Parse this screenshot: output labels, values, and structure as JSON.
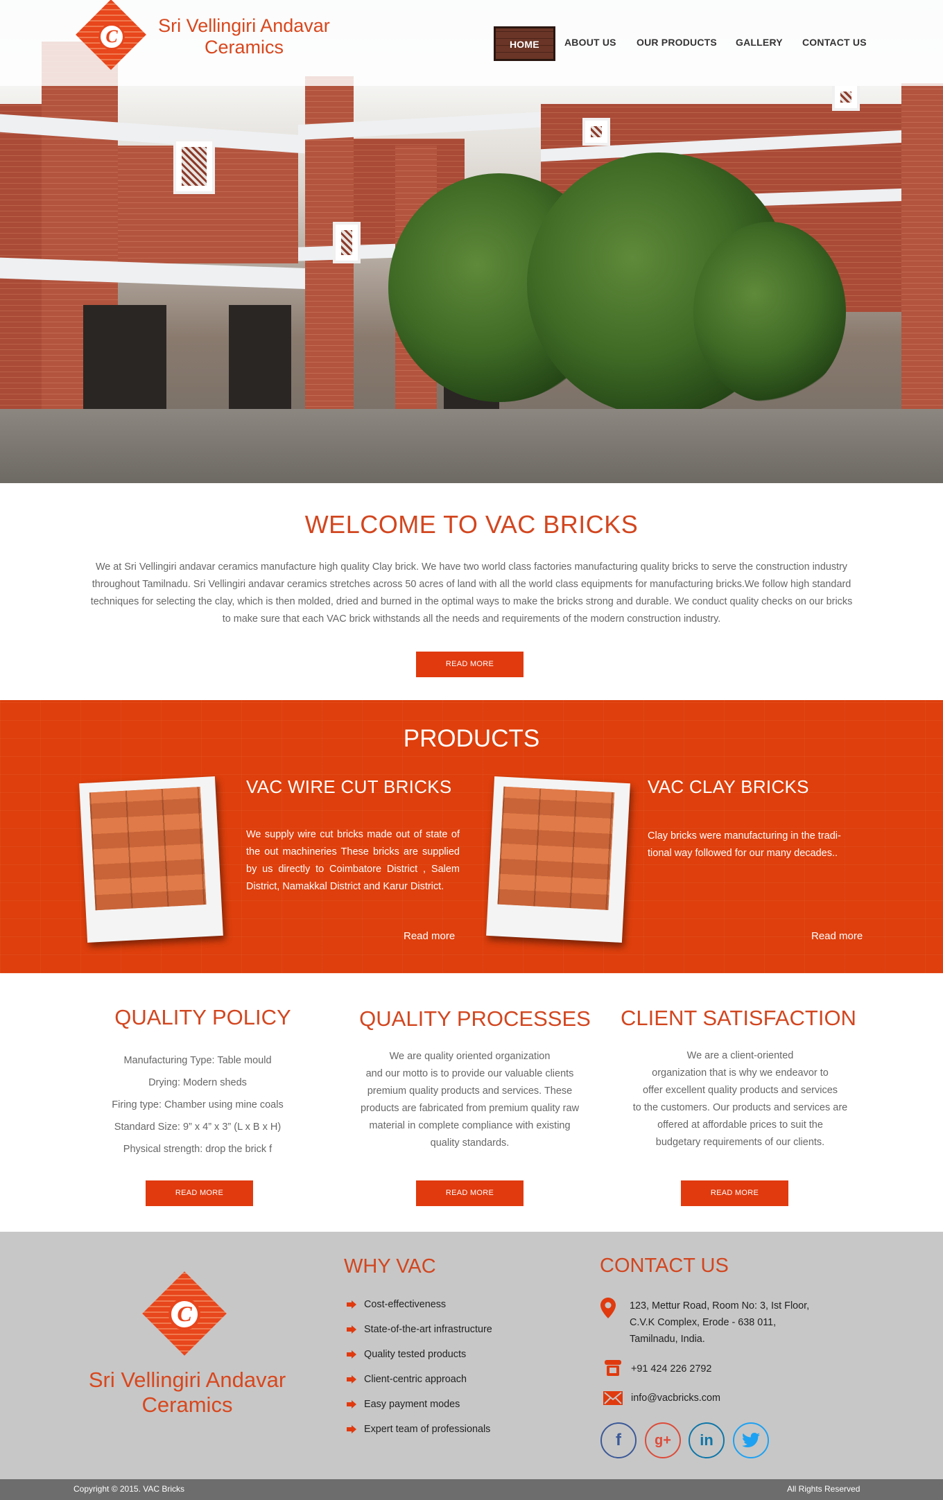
{
  "brand": {
    "name_line1": "Sri Vellingiri Andavar",
    "name_line2": "Ceramics",
    "logo_letter": "C",
    "accent_color": "#e03a0e",
    "title_color": "#d2461f"
  },
  "nav": {
    "items": [
      {
        "label": "HOME",
        "active": true
      },
      {
        "label": "ABOUT US"
      },
      {
        "label": "OUR PRODUCTS"
      },
      {
        "label": "GALLERY"
      },
      {
        "label": "CONTACT US"
      }
    ]
  },
  "welcome": {
    "title": "WELCOME TO VAC  BRICKS",
    "text": "We at Sri Vellingiri andavar ceramics manufacture high quality Clay brick. We have two world class factories manufacturing quality bricks to serve the construction industry throughout Tamilnadu. Sri Vellingiri andavar ceramics stretches across 50 acres of land with all the world class equipments for manufacturing bricks.We follow high standard techniques for selecting the clay, which is then molded, dried and burned in the optimal ways to make the bricks strong and durable. We conduct quality checks on our bricks to make sure that each VAC brick withstands all the needs and requirements of the modern construction industry.",
    "button": "READ MORE"
  },
  "products": {
    "title": "PRODUCTS",
    "items": [
      {
        "title": "VAC WIRE CUT BRICKS",
        "text": "We supply wire cut bricks made out of state of the out machineries  These  bricks  are supplied by   us directly to Coimbatore District , Salem  District, Namakkal District and Karur District.",
        "more": "Read more"
      },
      {
        "title": "VAC CLAY BRICKS",
        "text": "Clay bricks were manufacturing in the tradi-tional  way followed for our many decades..",
        "more": "Read more"
      }
    ]
  },
  "quality": {
    "columns": [
      {
        "title": "QUALITY POLICY",
        "lines": [
          "Manufacturing Type: Table mould",
          "Drying: Modern sheds",
          "Firing type: Chamber using mine coals",
          "Standard Size: 9” x 4” x 3” (L x B x H)",
          "Physical strength: drop the brick f"
        ],
        "button": "READ MORE"
      },
      {
        "title": "QUALITY PROCESSES",
        "lines": [
          "We are quality oriented organization",
          "and our motto is to provide our valuable clients",
          "premium quality products and services.  These",
          "products are fabricated from premium quality raw",
          "material in complete compliance with existing",
          "quality standards."
        ],
        "button": "READ MORE"
      },
      {
        "title": "CLIENT SATISFACTION",
        "lines": [
          "We are a client-oriented",
          "organization that is why we endeavor to",
          "offer excellent quality products and services",
          "to the customers. Our products and services are",
          "offered at affordable prices to suit the",
          "budgetary requirements of our clients."
        ],
        "button": "READ MORE"
      }
    ]
  },
  "footer": {
    "why_title": "WHY VAC",
    "why_items": [
      "Cost-effectiveness",
      "State-of-the-art infrastructure",
      "Quality tested products",
      "Client-centric approach",
      "Easy payment modes",
      "Expert team of professionals"
    ],
    "contact_title": "CONTACT US",
    "address_lines": [
      "123, Mettur Road, Room No: 3, Ist Floor,",
      "C.V.K Complex, Erode - 638 011,",
      "Tamilnadu, India."
    ],
    "phone": "+91 424  226 2792",
    "email": "info@vacbricks.com",
    "social": [
      {
        "icon": "facebook-icon",
        "glyph": "f",
        "color": "#3b5998"
      },
      {
        "icon": "google-plus-icon",
        "glyph": "g+",
        "color": "#dd4b39"
      },
      {
        "icon": "linkedin-icon",
        "glyph": "in",
        "color": "#0e76a8"
      },
      {
        "icon": "twitter-icon",
        "glyph": "t",
        "color": "#1da1f2"
      }
    ],
    "copyright": "Copyright © 2015. VAC Bricks",
    "rights": "All Rights Reserved"
  }
}
